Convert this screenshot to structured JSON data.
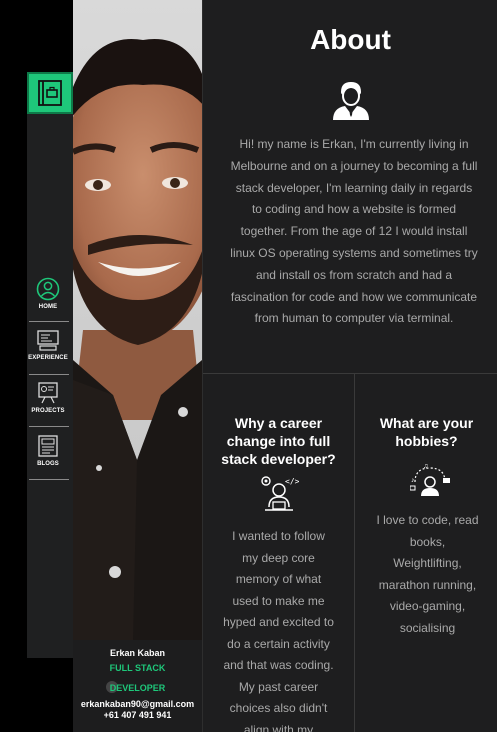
{
  "sidebar": {
    "logo_icon": "portfolio-book-icon",
    "items": [
      {
        "label": "HOME",
        "icon": "user-circle-icon"
      },
      {
        "label": "EXPERIENCE",
        "icon": "monitor-icon"
      },
      {
        "label": "PROJECTS",
        "icon": "whiteboard-icon"
      },
      {
        "label": "BLOGS",
        "icon": "document-icon"
      }
    ],
    "accent": "#1ec77a"
  },
  "profile": {
    "name": "Erkan Kaban",
    "role_line1": "FULL STACK",
    "role_line2": "DEVELOPER",
    "email": "erkankaban90@gmail.com",
    "phone": "+61 407 491 941"
  },
  "about": {
    "title": "About",
    "icon": "businessman-icon",
    "text": "Hi! my name is Erkan, I'm currently living in Melbourne and on a journey to becoming a full stack developer, I'm learning daily in regards to coding and how a website is formed together. From the age of 12 I would install linux OS operating systems and sometimes try and install os from scratch and had a fascination for code and how we communicate from human to computer via terminal."
  },
  "career": {
    "heading": "Why a career change into full stack developer?",
    "icon": "developer-gears-icon",
    "text": "I wanted to follow my deep core memory of what used to make me hyped and excited to do a certain activity and that was coding. My past career choices also didn't align with my"
  },
  "hobbies": {
    "heading": "What are your hobbies?",
    "icon": "gamer-music-icon",
    "text": "I love to code, read books, Weightlifting, marathon running, video-gaming, socialising"
  }
}
